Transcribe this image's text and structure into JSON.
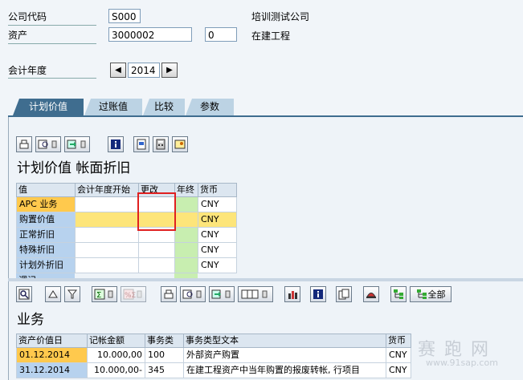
{
  "header": {
    "company_code_label": "公司代码",
    "company_code_value": "S000",
    "company_name": "培训测试公司",
    "asset_label": "资产",
    "asset_value": "3000002",
    "asset_sub_value": "0",
    "asset_desc": "在建工程",
    "fiscal_year_label": "会计年度",
    "fiscal_year_value": "2014"
  },
  "tabs": [
    {
      "label": "计划价值"
    },
    {
      "label": "过账值"
    },
    {
      "label": "比较"
    },
    {
      "label": "参数"
    }
  ],
  "upper": {
    "title": "计划价值 帐面折旧",
    "columns": [
      "值",
      "会计年度开始",
      "更改",
      "年终",
      "货币"
    ],
    "rows": [
      {
        "label": "APC 业务",
        "currency": "CNY"
      },
      {
        "label": "购置价值",
        "currency": "CNY"
      },
      {
        "label": "正常折旧",
        "currency": "CNY"
      },
      {
        "label": "特殊折旧",
        "currency": "CNY"
      },
      {
        "label": "计划外折旧",
        "currency": "CNY"
      },
      {
        "label": "调记",
        "currency": ""
      }
    ]
  },
  "lower": {
    "title": "业务",
    "all_button_label": "全部",
    "columns": [
      "资产价值日",
      "记帐金额",
      "事务类",
      "事务类型文本",
      "货币"
    ],
    "rows": [
      {
        "date": "01.12.2014",
        "amount": "10.000,00",
        "ttype": "100",
        "text": "外部资产购置",
        "currency": "CNY"
      },
      {
        "date": "31.12.2014",
        "amount": "10.000,00-",
        "ttype": "345",
        "text": "在建工程资产中当年购置的报废转帐, 行项目",
        "currency": "CNY"
      }
    ]
  },
  "watermark": {
    "brand": "赛 跑 网",
    "url": "www.91sap.com"
  }
}
